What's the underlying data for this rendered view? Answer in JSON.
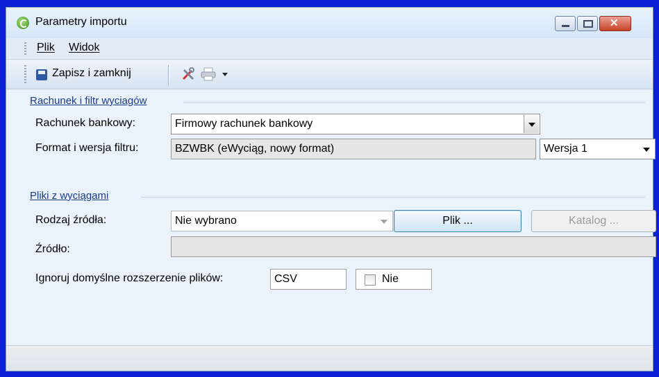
{
  "window": {
    "title": "Parametry importu"
  },
  "menu": {
    "items": [
      {
        "label": "Plik"
      },
      {
        "label": "Widok"
      }
    ]
  },
  "toolbar": {
    "save_label": "Zapisz i zamknij"
  },
  "section1": {
    "title": "Rachunek i filtr wyciagów",
    "account_label": "Rachunek bankowy:",
    "account_value": "Firmowy rachunek bankowy",
    "filter_label": "Format i wersja filtru:",
    "filter_value": "BZWBK (eWyciąg, nowy format)",
    "version_value": "Wersja 1"
  },
  "section2": {
    "title": "Pliki z wyciągami",
    "source_type_label": "Rodzaj źródła:",
    "source_type_value": "Nie wybrano",
    "file_button": "Plik ...",
    "folder_button": "Katalog ...",
    "source_label": "Źródło:",
    "source_value": "",
    "ignore_ext_label": "Ignoruj domyślne rozszerzenie plików:",
    "ext_value": "CSV",
    "ignore_checkbox_label": "Nie",
    "ignore_checked": false
  },
  "status": {
    "text": ""
  }
}
